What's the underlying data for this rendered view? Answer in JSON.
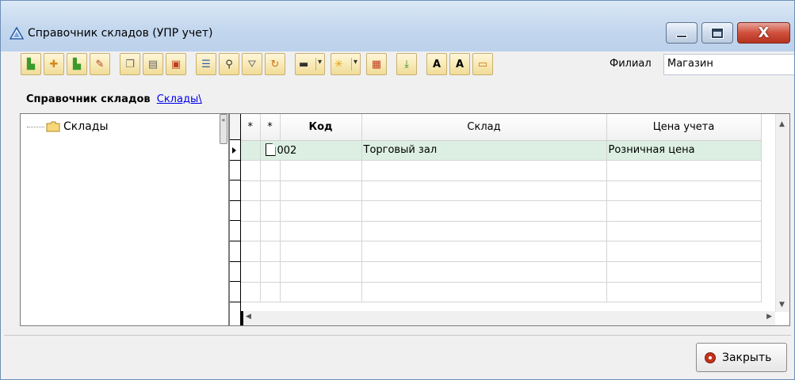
{
  "window": {
    "title": "Справочник складов (УПР учет)",
    "close_glyph": "X"
  },
  "toolbar": {
    "icons": [
      "add-group-icon",
      "add-element-icon",
      "add-copy-icon",
      "edit-icon",
      "copy-icon",
      "paste-icon",
      "delete-icon",
      "list-view-icon",
      "search-binoculars-icon",
      "filter-icon",
      "refresh-icon",
      "print-icon",
      "settings-icon",
      "export-icon",
      "import-icon",
      "font-larger-icon",
      "font-smaller-icon",
      "info-icon"
    ],
    "filial_label": "Филиал",
    "filial_value": "Магазин"
  },
  "breadcrumb": {
    "title": "Справочник складов",
    "link": "Склады\\"
  },
  "tree": {
    "root_label": "Склады"
  },
  "grid": {
    "columns": [
      "*",
      "*",
      "Код",
      "Склад",
      "Цена учета"
    ],
    "rows": [
      {
        "code": "002",
        "name": "Торговый зал",
        "price": "Розничная цена"
      }
    ]
  },
  "footer": {
    "close_label": "Закрыть"
  },
  "colors": {
    "selected_row": "#dcefe2",
    "title_bar": "#c3d7ee",
    "close_button": "#c4321b"
  }
}
